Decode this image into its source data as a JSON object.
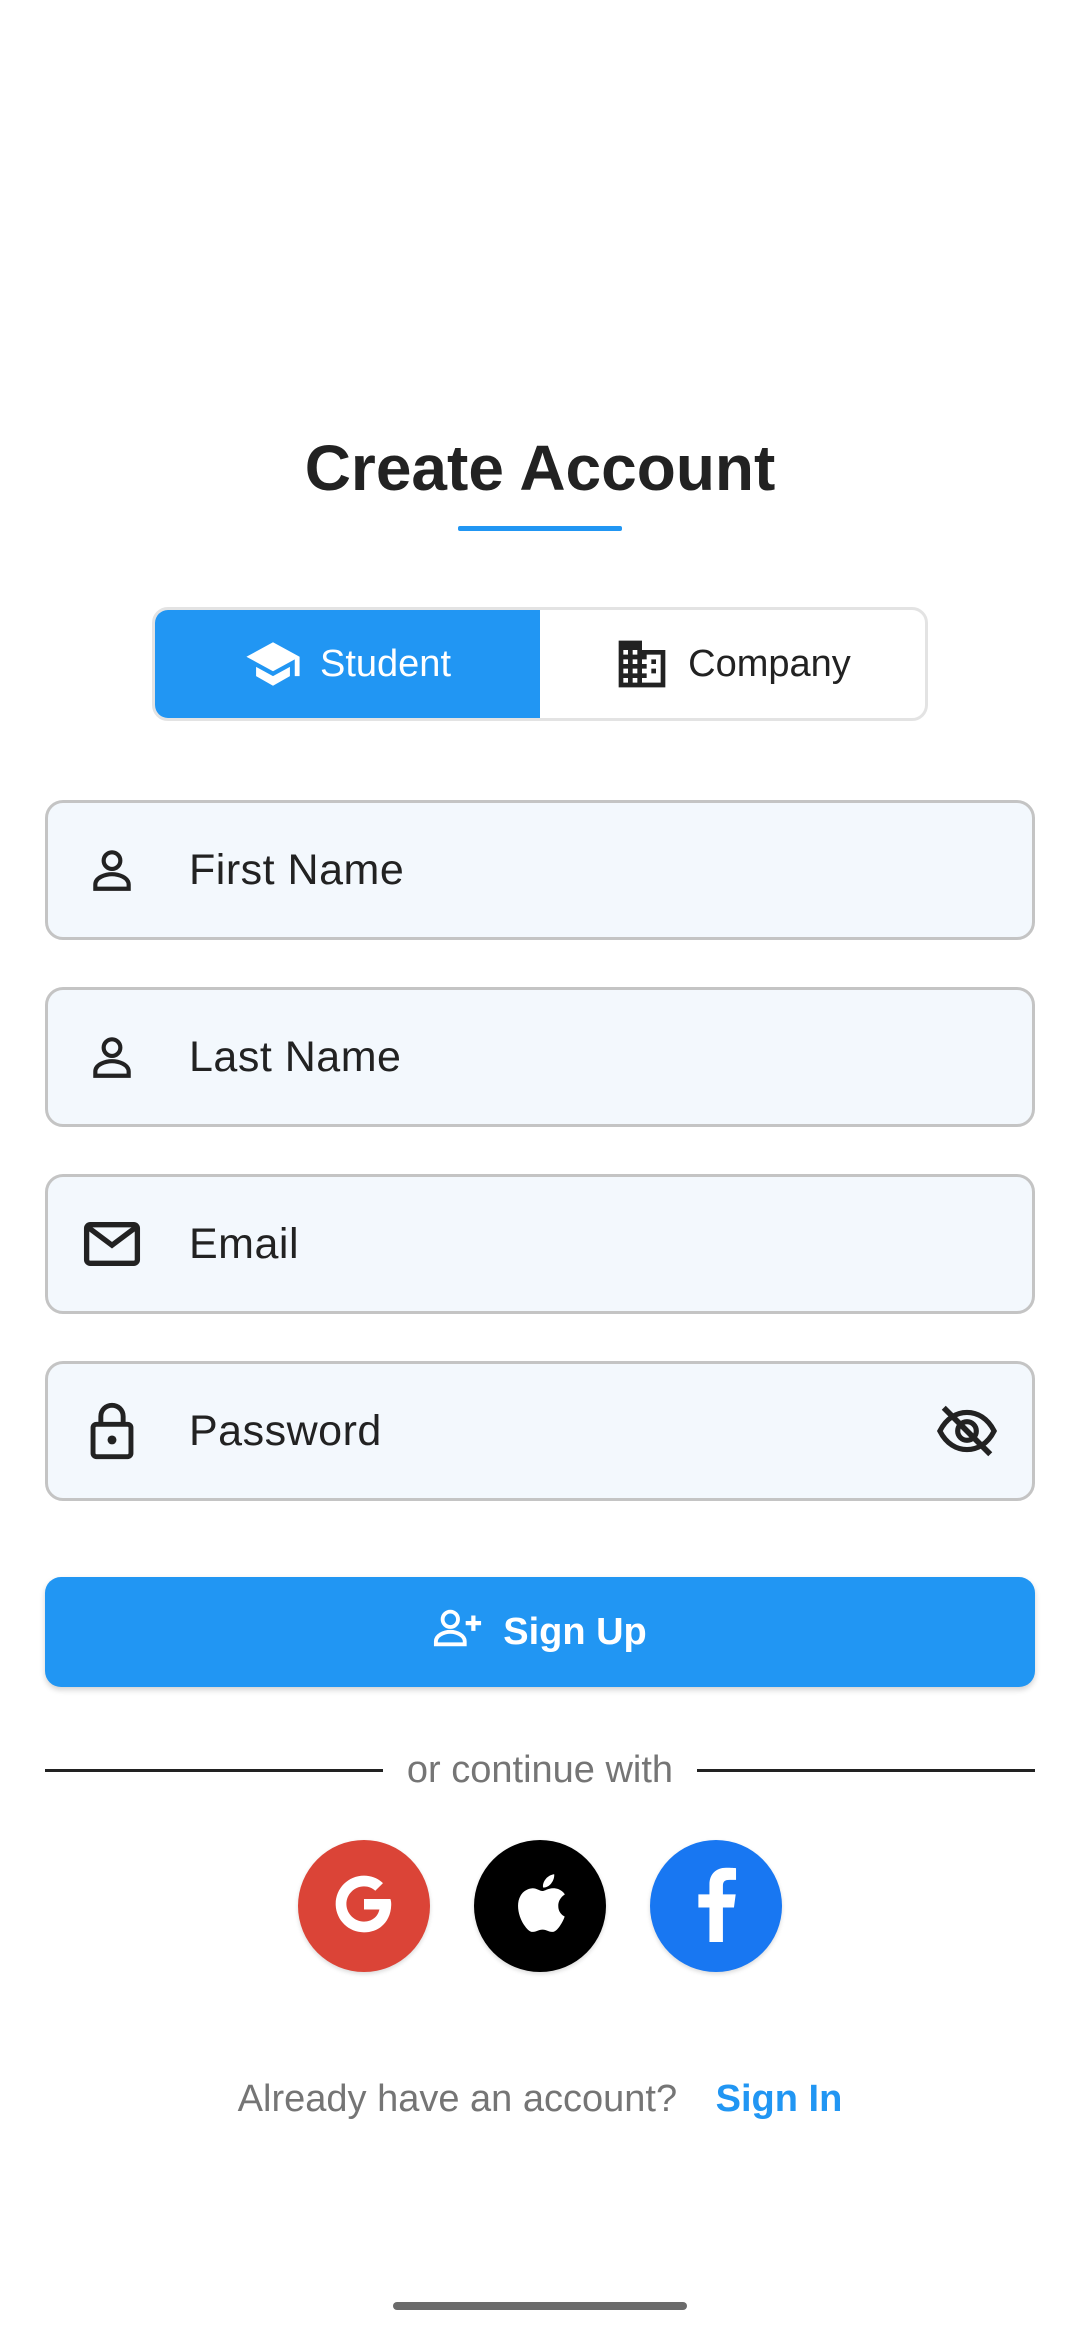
{
  "header": {
    "title": "Create Account"
  },
  "account_type": {
    "options": [
      {
        "label": "Student",
        "icon": "graduation-cap-icon",
        "selected": true
      },
      {
        "label": "Company",
        "icon": "building-icon",
        "selected": false
      }
    ]
  },
  "form": {
    "first_name": {
      "placeholder": "First Name",
      "value": "",
      "icon": "person-icon"
    },
    "last_name": {
      "placeholder": "Last Name",
      "value": "",
      "icon": "person-icon"
    },
    "email": {
      "placeholder": "Email",
      "value": "",
      "icon": "mail-icon"
    },
    "password": {
      "placeholder": "Password",
      "value": "",
      "icon": "lock-icon",
      "trailing_icon": "visibility-off-icon"
    }
  },
  "signup_button": {
    "label": "Sign Up",
    "icon": "person-add-icon"
  },
  "divider": {
    "text": "or continue with"
  },
  "social": [
    {
      "name": "google",
      "icon": "google-icon",
      "color": "#db4437"
    },
    {
      "name": "apple",
      "icon": "apple-icon",
      "color": "#000000"
    },
    {
      "name": "facebook",
      "icon": "facebook-icon",
      "color": "#1877f2"
    }
  ],
  "footer": {
    "prompt": "Already have an account?",
    "link": "Sign In"
  },
  "colors": {
    "accent": "#2196f3",
    "field_background": "#f3f8fd",
    "field_border": "#c4c4c4",
    "muted_text": "#757575"
  }
}
